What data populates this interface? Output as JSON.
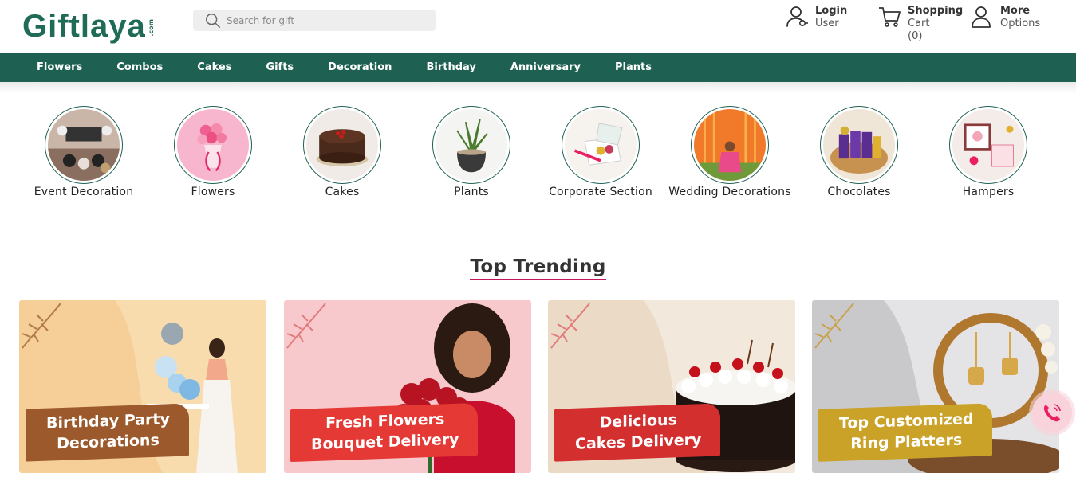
{
  "brand": {
    "logo_text": "Giftlaya",
    "logo_suffix": ".com",
    "color": "#1f6b58"
  },
  "search": {
    "placeholder": "Search for gift"
  },
  "header_actions": {
    "login": {
      "title": "Login",
      "subtitle": "User"
    },
    "cart": {
      "title": "Shopping",
      "subtitle": "Cart",
      "count": "(0)"
    },
    "more": {
      "title": "More",
      "subtitle": "Options"
    }
  },
  "nav": {
    "color": "#1e6152",
    "items": [
      "Flowers",
      "Combos",
      "Cakes",
      "Gifts",
      "Decoration",
      "Birthday",
      "Anniversary",
      "Plants"
    ]
  },
  "categories": [
    {
      "label": "Event Decoration",
      "image": "balloon-decor"
    },
    {
      "label": "Flowers",
      "image": "pink-bouquet"
    },
    {
      "label": "Cakes",
      "image": "chocolate-cake"
    },
    {
      "label": "Plants",
      "image": "potted-plant"
    },
    {
      "label": "Corporate Section",
      "image": "gift-box"
    },
    {
      "label": "Wedding Decorations",
      "image": "wedding-decor"
    },
    {
      "label": "Chocolates",
      "image": "chocolate-hamper"
    },
    {
      "label": "Hampers",
      "image": "gift-hamper"
    }
  ],
  "trending": {
    "title": "Top Trending",
    "accent": "#c2185b",
    "cards": [
      {
        "line1": "Birthday Party",
        "line2": "Decorations",
        "ribbon_color": "#9c5a2c"
      },
      {
        "line1": "Fresh Flowers",
        "line2": "Bouquet Delivery",
        "ribbon_color": "#e53935"
      },
      {
        "line1": "Delicious",
        "line2": "Cakes Delivery",
        "ribbon_color": "#d32f2f"
      },
      {
        "line1": "Top Customized",
        "line2": "Ring Platters",
        "ribbon_color": "#c9a227"
      }
    ]
  },
  "call_button": {
    "icon": "phone-icon",
    "color": "#e91e63"
  }
}
